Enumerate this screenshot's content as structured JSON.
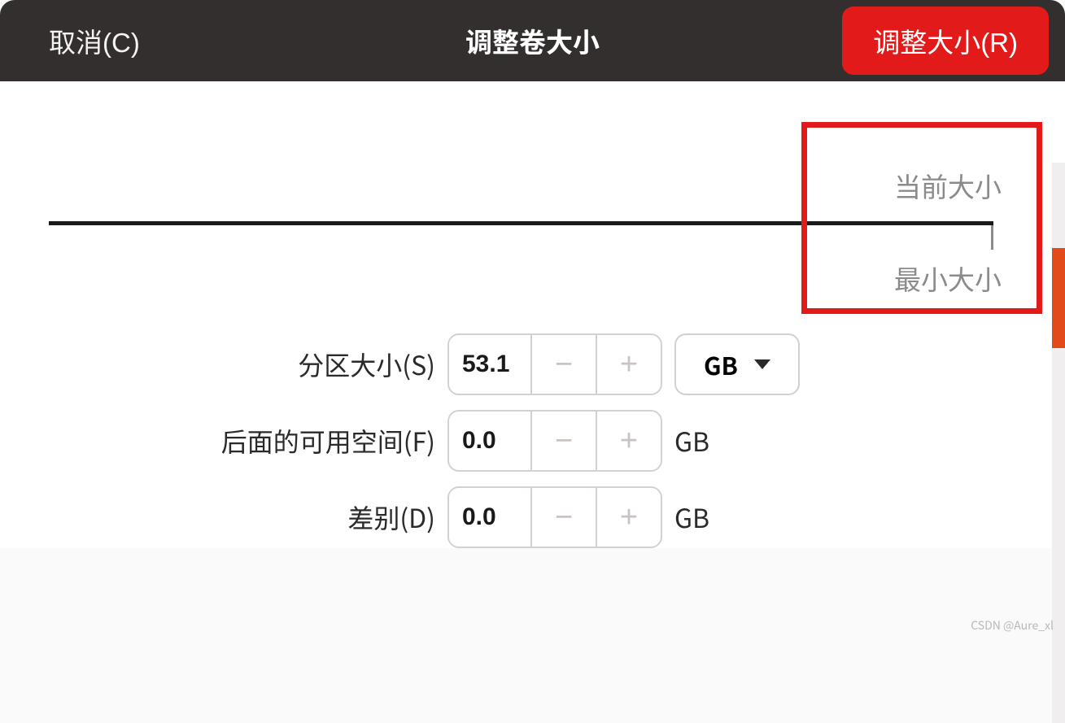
{
  "header": {
    "cancel_label": "取消(C)",
    "title": "调整卷大小",
    "resize_label": "调整大小(R)"
  },
  "slider": {
    "current_size_label": "当前大小",
    "min_size_label": "最小大小"
  },
  "form": {
    "partition_size": {
      "label": "分区大小(S)",
      "value": "53.1",
      "unit": "GB"
    },
    "free_space_after": {
      "label": "后面的可用空间(F)",
      "value": "0.0",
      "unit": "GB"
    },
    "difference": {
      "label": "差别(D)",
      "value": "0.0",
      "unit": "GB"
    }
  },
  "watermark": "CSDN @Aure_xl"
}
